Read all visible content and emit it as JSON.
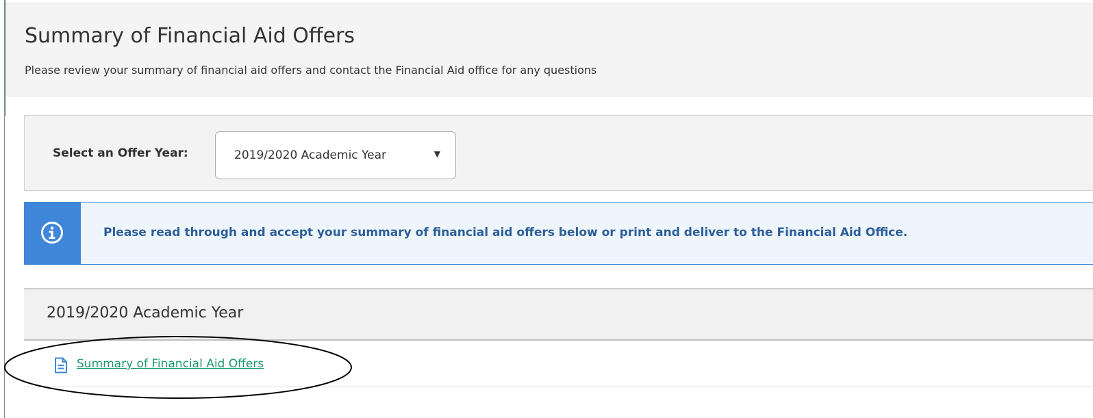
{
  "header": {
    "title": "Summary of Financial Aid Offers",
    "subtitle": "Please review your summary of financial aid offers and contact the Financial Aid office for any questions"
  },
  "offer_year": {
    "label": "Select an Offer Year:",
    "selected": "2019/2020 Academic Year",
    "caret": "▼"
  },
  "alert": {
    "icon": "info-icon",
    "message": "Please read through and accept your summary of financial aid offers below or print and deliver to the Financial Aid Office."
  },
  "section": {
    "title": "2019/2020 Academic Year",
    "documents": [
      {
        "icon": "document-icon",
        "label": "Summary of Financial Aid Offers"
      }
    ]
  },
  "colors": {
    "alert_accent": "#3f86d9",
    "alert_text": "#2d5f99",
    "link": "#1d9a6c",
    "annotation": "#000000"
  }
}
